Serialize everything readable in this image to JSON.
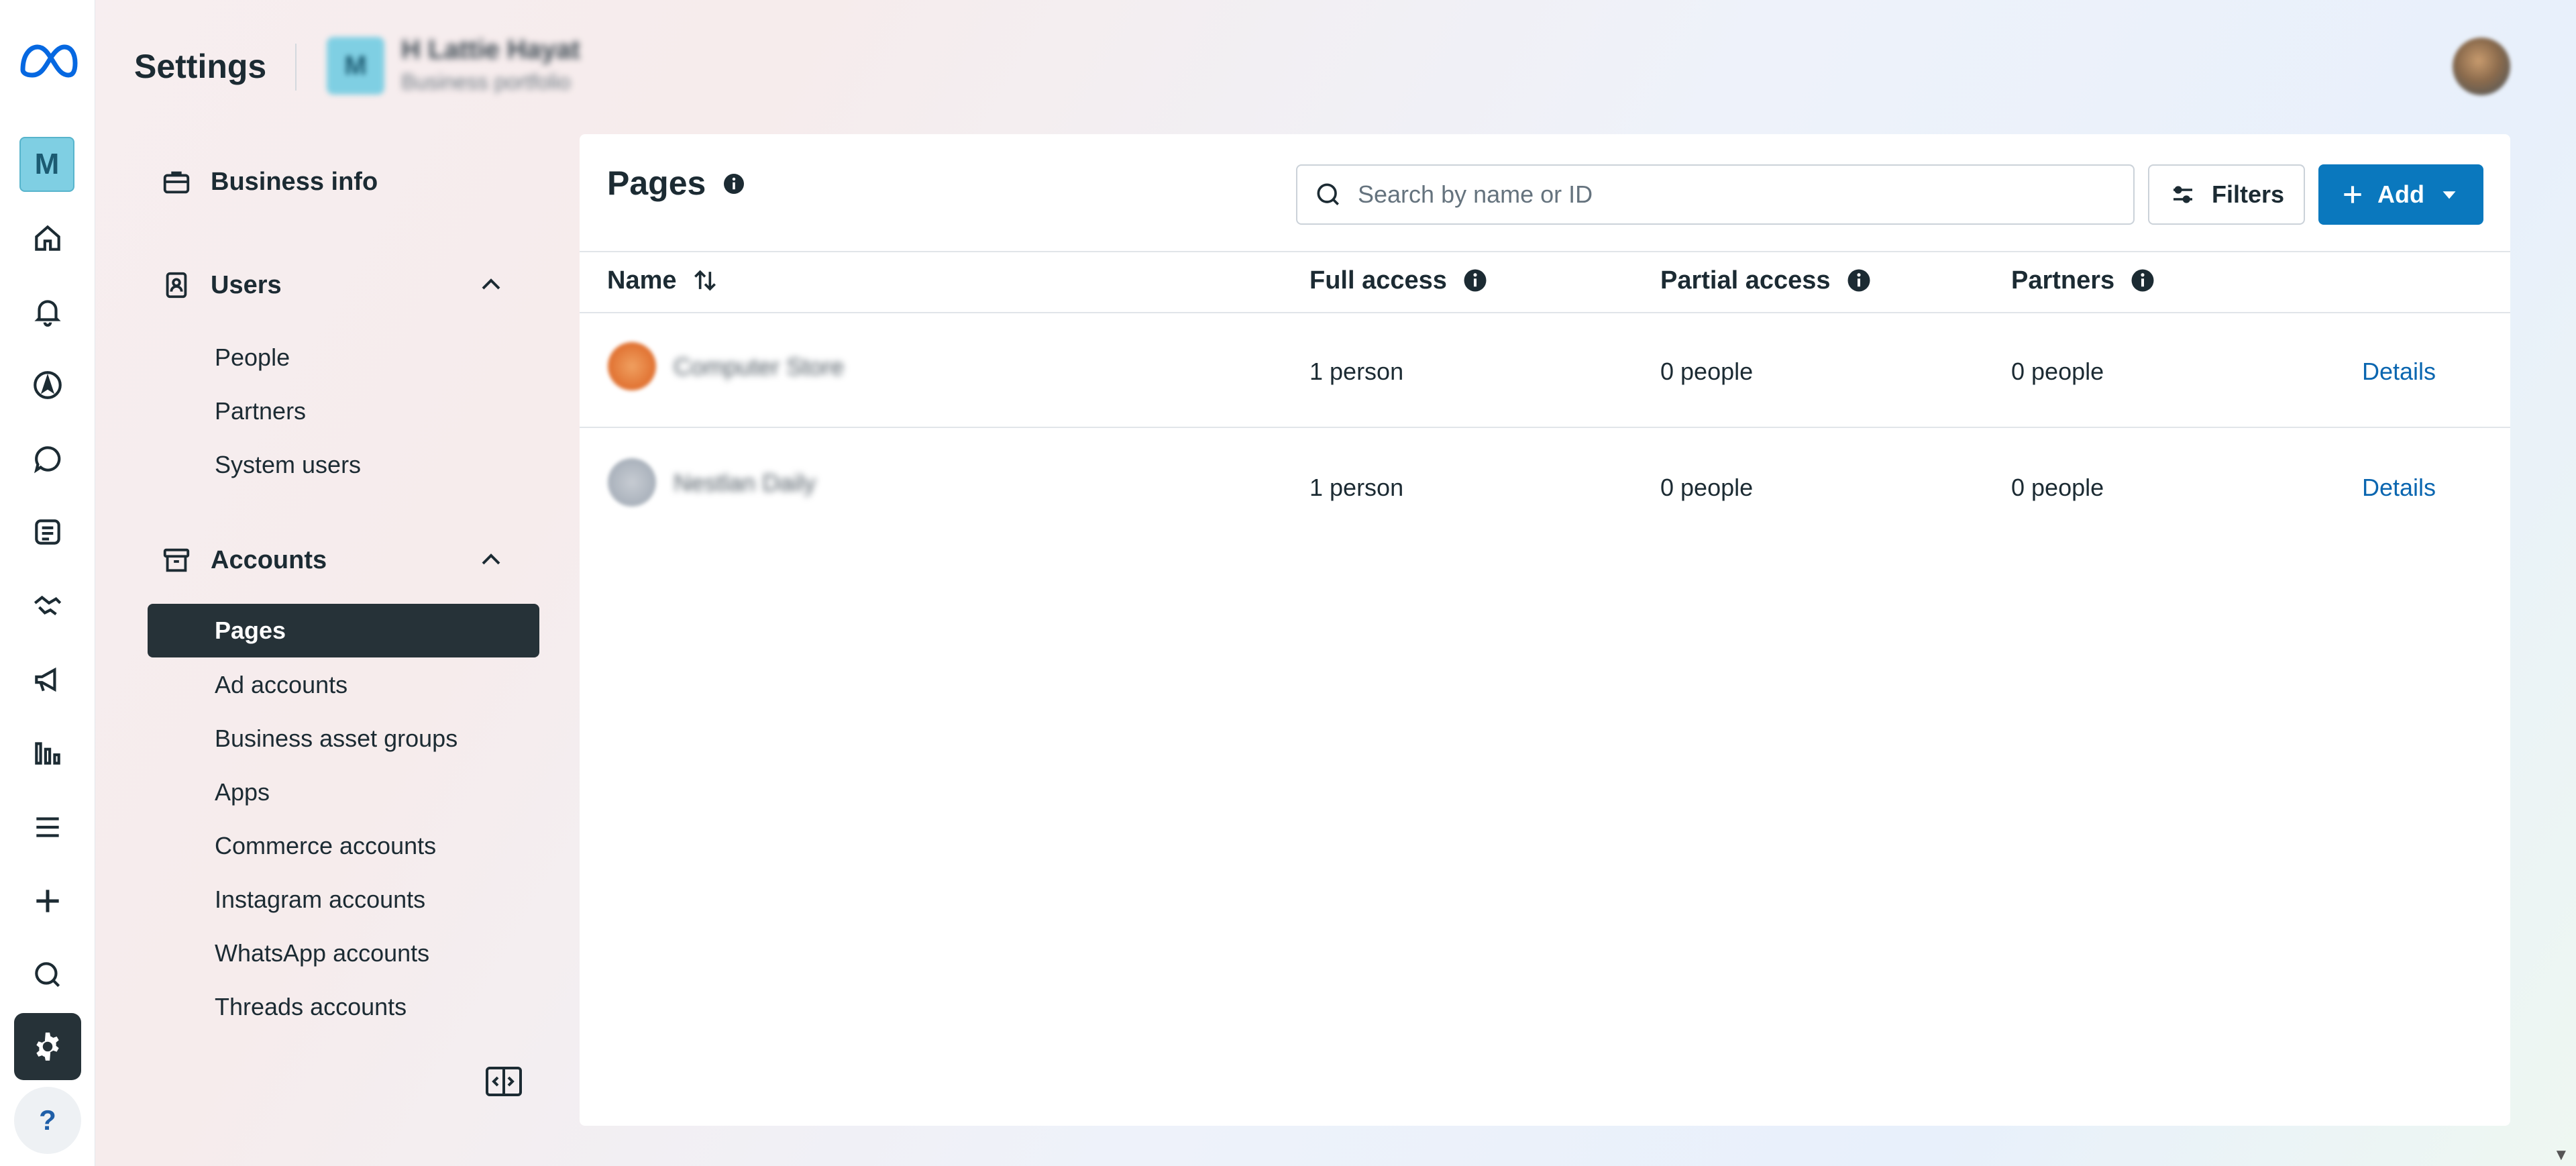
{
  "header": {
    "title": "Settings",
    "account_initial": "M",
    "account_name": "H Lattie Hayat",
    "account_subtitle": "Business portfolio"
  },
  "rail": {
    "account_initial": "M",
    "help_label": "?",
    "icons": [
      "meta-logo",
      "home-icon",
      "bell-icon",
      "compass-icon",
      "chat-icon",
      "content-icon",
      "handshake-icon",
      "megaphone-icon",
      "insights-icon",
      "menu-icon",
      "plus-icon",
      "search-icon",
      "gear-icon",
      "help-icon"
    ]
  },
  "nav": {
    "business_info": "Business info",
    "users": {
      "label": "Users",
      "items": [
        "People",
        "Partners",
        "System users"
      ]
    },
    "accounts": {
      "label": "Accounts",
      "active": "Pages",
      "items": [
        "Ad accounts",
        "Business asset groups",
        "Apps",
        "Commerce accounts",
        "Instagram accounts",
        "WhatsApp accounts",
        "Threads accounts"
      ]
    }
  },
  "main": {
    "title": "Pages",
    "search_placeholder": "Search by name or ID",
    "filters_label": "Filters",
    "add_label": "Add",
    "columns": [
      "Name",
      "Full access",
      "Partial access",
      "Partners"
    ],
    "rows": [
      {
        "name": "Computer Store",
        "full": "1 person",
        "partial": "0 people",
        "partners": "0 people",
        "action": "Details"
      },
      {
        "name": "Nestlan Daily",
        "full": "1 person",
        "partial": "0 people",
        "partners": "0 people",
        "action": "Details"
      }
    ]
  },
  "colors": {
    "accent": "#0a78be",
    "active_nav": "#263238",
    "link": "#0a66b0"
  }
}
